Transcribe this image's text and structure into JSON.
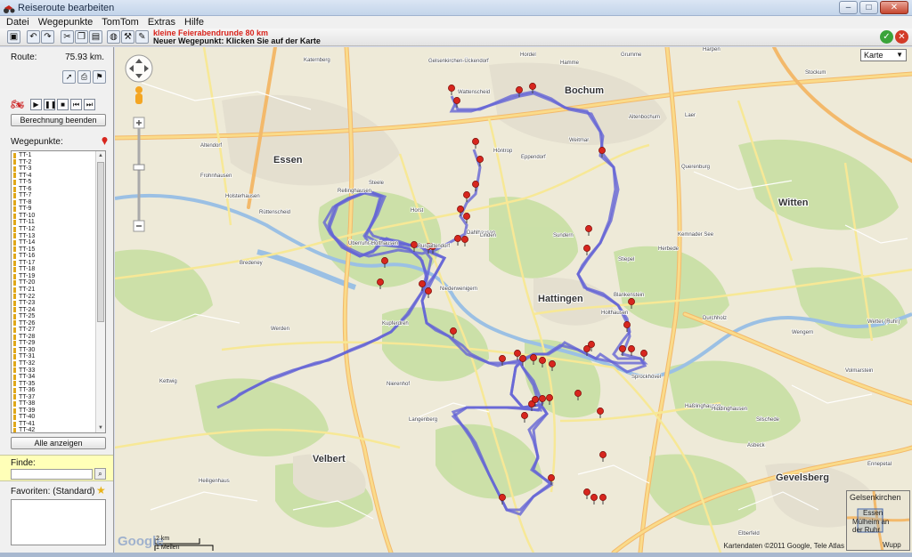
{
  "window": {
    "title": "Reiseroute bearbeiten",
    "buttons": {
      "minimize": "–",
      "maximize": "□",
      "close": "✕"
    }
  },
  "menu": [
    "Datei",
    "Wegepunkte",
    "TomTom",
    "Extras",
    "Hilfe"
  ],
  "toolbar": {
    "message_line1": "kleine Feierabendrunde 80 km",
    "message_line2": "Neuer Wegepunkt: Klicken Sie auf der Karte"
  },
  "route": {
    "label": "Route:",
    "distance": "75.93 km."
  },
  "buttons": {
    "calc_end": "Berechnung beenden",
    "show_all": "Alle anzeigen"
  },
  "waypoints": {
    "label": "Wegepunkte:",
    "items": [
      "TT-1",
      "TT-2",
      "TT-3",
      "TT-4",
      "TT-5",
      "TT-6",
      "TT-7",
      "TT-8",
      "TT-9",
      "TT-10",
      "TT-11",
      "TT-12",
      "TT-13",
      "TT-14",
      "TT-15",
      "TT-16",
      "TT-17",
      "TT-18",
      "TT-19",
      "TT-20",
      "TT-21",
      "TT-22",
      "TT-23",
      "TT-24",
      "TT-25",
      "TT-26",
      "TT-27",
      "TT-28",
      "TT-29",
      "TT-30",
      "TT-31",
      "TT-32",
      "TT-33",
      "TT-34",
      "TT-35",
      "TT-36",
      "TT-37",
      "TT-38",
      "TT-39",
      "TT-40",
      "TT-41",
      "TT-42"
    ]
  },
  "find": {
    "label": "Finde:",
    "value": ""
  },
  "favorites": {
    "label": "Favoriten: (Standard)"
  },
  "map": {
    "type_selector": "Karte",
    "copyright": "Kartendaten ©2011 Google, Tele Atlas",
    "logo": "Google",
    "scale_km": "2 km",
    "scale_mi": "1 Meilen",
    "overview_labels": [
      "Gelsenkirchen",
      "Essen",
      "Mülheim an der Ruhr",
      "Wupp"
    ],
    "places": [
      {
        "name": "Bochum",
        "big": true
      },
      {
        "name": "Essen",
        "big": true
      },
      {
        "name": "Witten",
        "big": true
      },
      {
        "name": "Hattingen",
        "big": true
      },
      {
        "name": "Velbert",
        "big": true
      },
      {
        "name": "Gevelsberg",
        "big": true
      },
      {
        "name": "Sprockhövel",
        "big": false
      },
      {
        "name": "Heiligenhaus",
        "big": false
      },
      {
        "name": "Dahlhausen",
        "big": false
      },
      {
        "name": "Wattenscheid",
        "big": false
      },
      {
        "name": "Horst",
        "big": false
      },
      {
        "name": "Linden",
        "big": false
      },
      {
        "name": "Weitmar",
        "big": false
      },
      {
        "name": "Stiepel",
        "big": false
      },
      {
        "name": "Blankenstein",
        "big": false
      },
      {
        "name": "Niederwenigern",
        "big": false
      },
      {
        "name": "Kupferdreh",
        "big": false
      },
      {
        "name": "Burgaltendorf",
        "big": false
      },
      {
        "name": "Überruhr-Holthausen",
        "big": false
      },
      {
        "name": "Werden",
        "big": false
      },
      {
        "name": "Langenberg",
        "big": false
      },
      {
        "name": "Haßlinghausen",
        "big": false
      },
      {
        "name": "Herbede",
        "big": false
      },
      {
        "name": "Wetter (Ruhr)",
        "big": false
      },
      {
        "name": "Volmarstein",
        "big": false
      },
      {
        "name": "Sundern",
        "big": false
      },
      {
        "name": "Höntrop",
        "big": false
      },
      {
        "name": "Eppendorf",
        "big": false
      },
      {
        "name": "Steele",
        "big": false
      },
      {
        "name": "Rellinghausen",
        "big": false
      },
      {
        "name": "Hordel",
        "big": false
      },
      {
        "name": "Hamme",
        "big": false
      },
      {
        "name": "Grumme",
        "big": false
      },
      {
        "name": "Harpen",
        "big": false
      },
      {
        "name": "Laer",
        "big": false
      },
      {
        "name": "Altenbochum",
        "big": false
      },
      {
        "name": "Querenburg",
        "big": false
      },
      {
        "name": "Kemnader See",
        "big": false
      },
      {
        "name": "Schwelm",
        "big": false
      },
      {
        "name": "Ennepetal",
        "big": false
      },
      {
        "name": "Breckerfeld",
        "big": false
      },
      {
        "name": "Elberfeld",
        "big": false
      },
      {
        "name": "Kettwig",
        "big": false
      },
      {
        "name": "Nierenhof",
        "big": false
      },
      {
        "name": "Stockum",
        "big": false
      },
      {
        "name": "Rüttenscheid",
        "big": false
      },
      {
        "name": "Katernberg",
        "big": false
      },
      {
        "name": "Gelsenkirchen-Ückendorf",
        "big": false
      },
      {
        "name": "Durchholz",
        "big": false
      },
      {
        "name": "Wengern",
        "big": false
      },
      {
        "name": "Silschede",
        "big": false
      },
      {
        "name": "Asbeck",
        "big": false
      },
      {
        "name": "Holthausen",
        "big": false
      },
      {
        "name": "Hiddinghausen",
        "big": false
      },
      {
        "name": "Bredeney",
        "big": false
      },
      {
        "name": "Holsterhausen",
        "big": false
      },
      {
        "name": "Frohnhausen",
        "big": false
      },
      {
        "name": "Altendorf",
        "big": false
      }
    ]
  }
}
